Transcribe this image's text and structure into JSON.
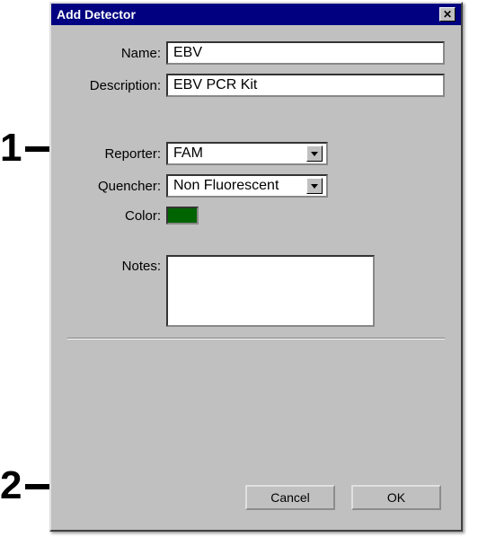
{
  "callouts": {
    "one": "1",
    "two": "2"
  },
  "dialog": {
    "title": "Add Detector",
    "close_glyph": "✕",
    "labels": {
      "name": "Name:",
      "description": "Description:",
      "reporter": "Reporter:",
      "quencher": "Quencher:",
      "color": "Color:",
      "notes": "Notes:"
    },
    "values": {
      "name": "EBV",
      "description": "EBV PCR Kit",
      "reporter": "FAM",
      "quencher": "Non Fluorescent",
      "color_hex": "#006400",
      "notes": ""
    },
    "buttons": {
      "cancel": "Cancel",
      "ok": "OK"
    }
  }
}
